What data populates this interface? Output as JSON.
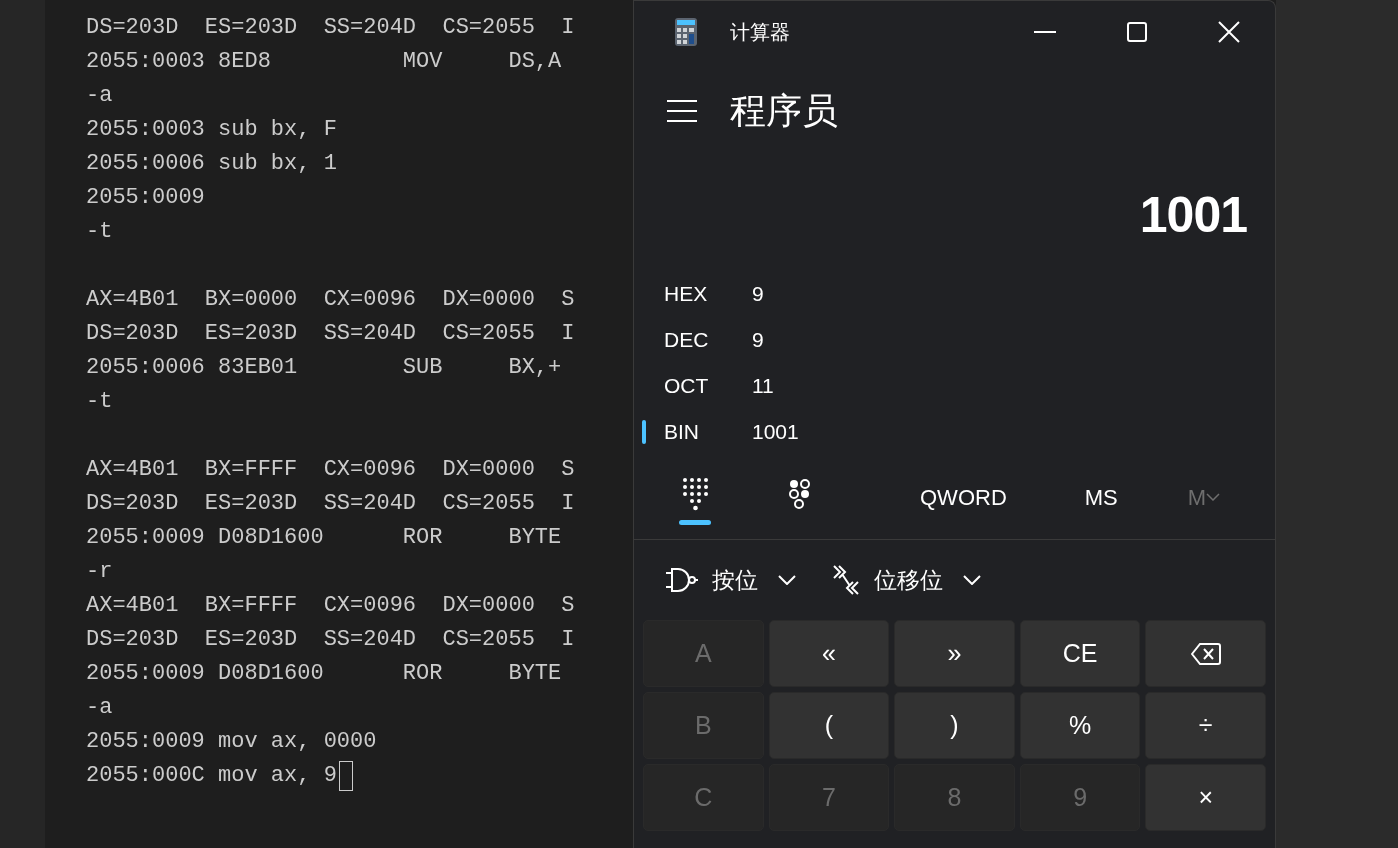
{
  "terminal": {
    "blocks": [
      [
        "DS=203D  ES=203D  SS=204D  CS=2055  I",
        "2055:0003 8ED8          MOV     DS,A",
        "-a",
        "2055:0003 sub bx, F",
        "2055:0006 sub bx, 1",
        "2055:0009",
        "-t"
      ],
      [
        "AX=4B01  BX=0000  CX=0096  DX=0000  S",
        "DS=203D  ES=203D  SS=204D  CS=2055  I",
        "2055:0006 83EB01        SUB     BX,+",
        "-t"
      ],
      [
        "AX=4B01  BX=FFFF  CX=0096  DX=0000  S",
        "DS=203D  ES=203D  SS=204D  CS=2055  I",
        "2055:0009 D08D1600      ROR     BYTE",
        "-r",
        "AX=4B01  BX=FFFF  CX=0096  DX=0000  S",
        "DS=203D  ES=203D  SS=204D  CS=2055  I",
        "2055:0009 D08D1600      ROR     BYTE",
        "-a",
        "2055:0009 mov ax, 0000",
        "2055:000C mov ax, 9"
      ]
    ],
    "cursor": true
  },
  "calculator": {
    "title": "计算器",
    "mode": "程序员",
    "display": "1001",
    "radix": [
      {
        "label": "HEX",
        "value": "9",
        "selected": false
      },
      {
        "label": "DEC",
        "value": "9",
        "selected": false
      },
      {
        "label": "OCT",
        "value": "11",
        "selected": false
      },
      {
        "label": "BIN",
        "value": "1001",
        "selected": true
      }
    ],
    "keypad_tabs": [
      {
        "kind": "keypad",
        "selected": true
      },
      {
        "kind": "bits",
        "selected": false
      }
    ],
    "word_size": "QWORD",
    "memory": [
      {
        "label": "MS",
        "disabled": false
      },
      {
        "label": "M",
        "disabled": true
      }
    ],
    "menus": [
      {
        "kind": "bitwise",
        "label": "按位"
      },
      {
        "kind": "shift",
        "label": "位移位"
      }
    ],
    "keys": [
      {
        "kind": "text",
        "label": "A",
        "disabled": true
      },
      {
        "kind": "text",
        "label": "«",
        "disabled": false
      },
      {
        "kind": "text",
        "label": "»",
        "disabled": false
      },
      {
        "kind": "text",
        "label": "CE",
        "disabled": false
      },
      {
        "kind": "backspace",
        "disabled": false
      },
      {
        "kind": "text",
        "label": "B",
        "disabled": true
      },
      {
        "kind": "text",
        "label": "(",
        "disabled": false
      },
      {
        "kind": "text",
        "label": ")",
        "disabled": false
      },
      {
        "kind": "text",
        "label": "%",
        "disabled": false
      },
      {
        "kind": "text",
        "label": "÷",
        "disabled": false
      },
      {
        "kind": "text",
        "label": "C",
        "disabled": true
      },
      {
        "kind": "text",
        "label": "7",
        "disabled": true
      },
      {
        "kind": "text",
        "label": "8",
        "disabled": true
      },
      {
        "kind": "text",
        "label": "9",
        "disabled": true
      },
      {
        "kind": "text",
        "label": "×",
        "disabled": false
      }
    ]
  }
}
